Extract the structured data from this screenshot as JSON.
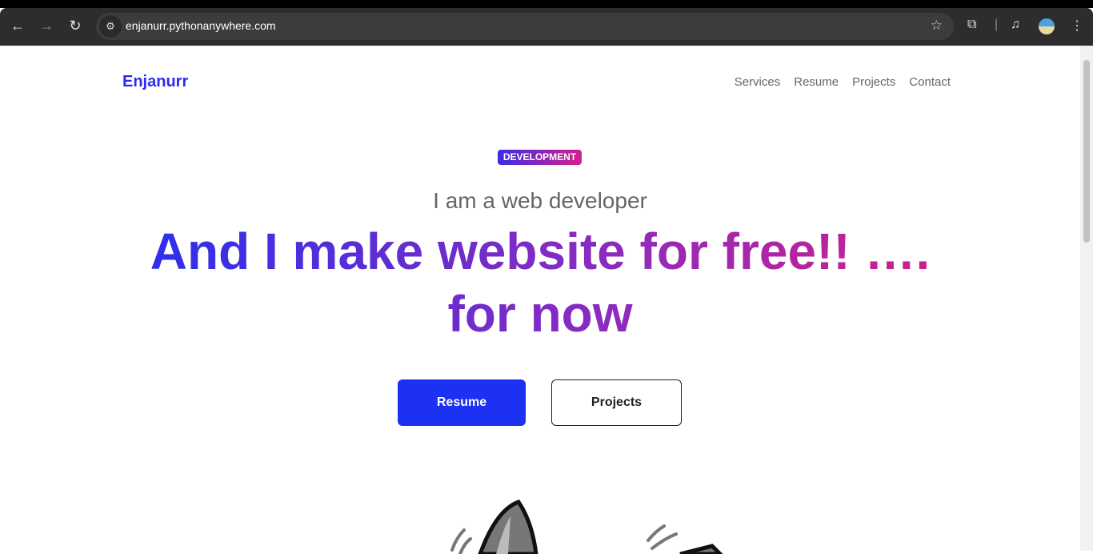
{
  "browser": {
    "url": "enjanurr.pythonanywhere.com"
  },
  "site": {
    "brand": "Enjanurr",
    "nav": [
      "Services",
      "Resume",
      "Projects",
      "Contact"
    ],
    "badge": "DEVELOPMENT",
    "subtitle": "I am a web developer",
    "headline_line1": "And I make website for free!! ….",
    "headline_line2": "for now",
    "buttons": {
      "resume": "Resume",
      "projects": "Projects"
    }
  },
  "colors": {
    "accent": "#1c31f2",
    "gradient_start": "#2530ef",
    "gradient_end": "#d41f87"
  }
}
